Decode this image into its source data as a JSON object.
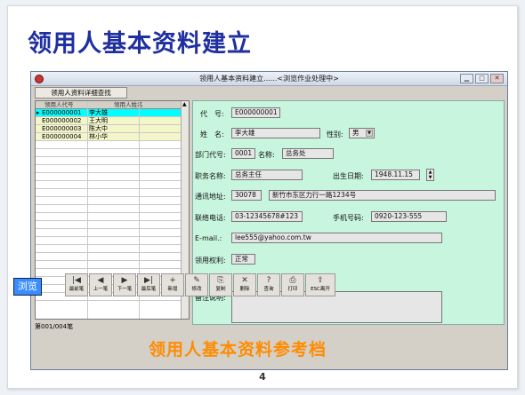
{
  "slide": {
    "title": "领用人基本资料建立",
    "watermark": "领用人基本资料参考档",
    "page_number": "4"
  },
  "window": {
    "title": "领用人基本资料建立......<浏览作业处理中>"
  },
  "toolbar": {
    "detail_search": "领用人资料详细查找"
  },
  "grid": {
    "headers": [
      "领用人代号",
      "领用人姓名"
    ],
    "rows": [
      {
        "code": "E000000001",
        "name": "李大雄"
      },
      {
        "code": "E000000002",
        "name": "王大明"
      },
      {
        "code": "E000000003",
        "name": "陈大中"
      },
      {
        "code": "E000000004",
        "name": "林小华"
      }
    ],
    "record_count": "第001/004笔"
  },
  "form": {
    "code_label": "代　号:",
    "code_value": "E000000001",
    "name_label": "姓　名:",
    "name_value": "李大雄",
    "gender_label": "性别:",
    "gender_value": "男",
    "dept_code_label": "部门代号:",
    "dept_code_value": "0001",
    "dept_name_label": "名称:",
    "dept_name_value": "总务处",
    "job_label": "职务名称:",
    "job_value": "总务主任",
    "birth_label": "出生日期:",
    "birth_value": "1948.11.15",
    "address_label": "通讯地址:",
    "zip_value": "30078",
    "address_value": "新竹市东区力行一路1234号",
    "phone_label": "联络电话:",
    "phone_value": "03-12345678#123",
    "mobile_label": "手机号码:",
    "mobile_value": "0920-123-555",
    "email_label": "E-mail.:",
    "email_value": "lee555@yahoo.com.tw",
    "rights_label": "领用权利:",
    "rights_value": "正常",
    "remark_label": "备注说明:"
  },
  "bottombar": {
    "browse": "浏览",
    "buttons": [
      {
        "icon": "|◀",
        "label": "最前笔"
      },
      {
        "icon": "◀",
        "label": "上一笔"
      },
      {
        "icon": "▶",
        "label": "下一笔"
      },
      {
        "icon": "▶|",
        "label": "最后笔"
      },
      {
        "icon": "+",
        "label": "新增"
      },
      {
        "icon": "✎",
        "label": "修改"
      },
      {
        "icon": "⎘",
        "label": "复制"
      },
      {
        "icon": "✕",
        "label": "删除"
      },
      {
        "icon": "?",
        "label": "查询"
      },
      {
        "icon": "⎙",
        "label": "打印"
      },
      {
        "icon": "⇪",
        "label": "ESC离开"
      }
    ]
  }
}
